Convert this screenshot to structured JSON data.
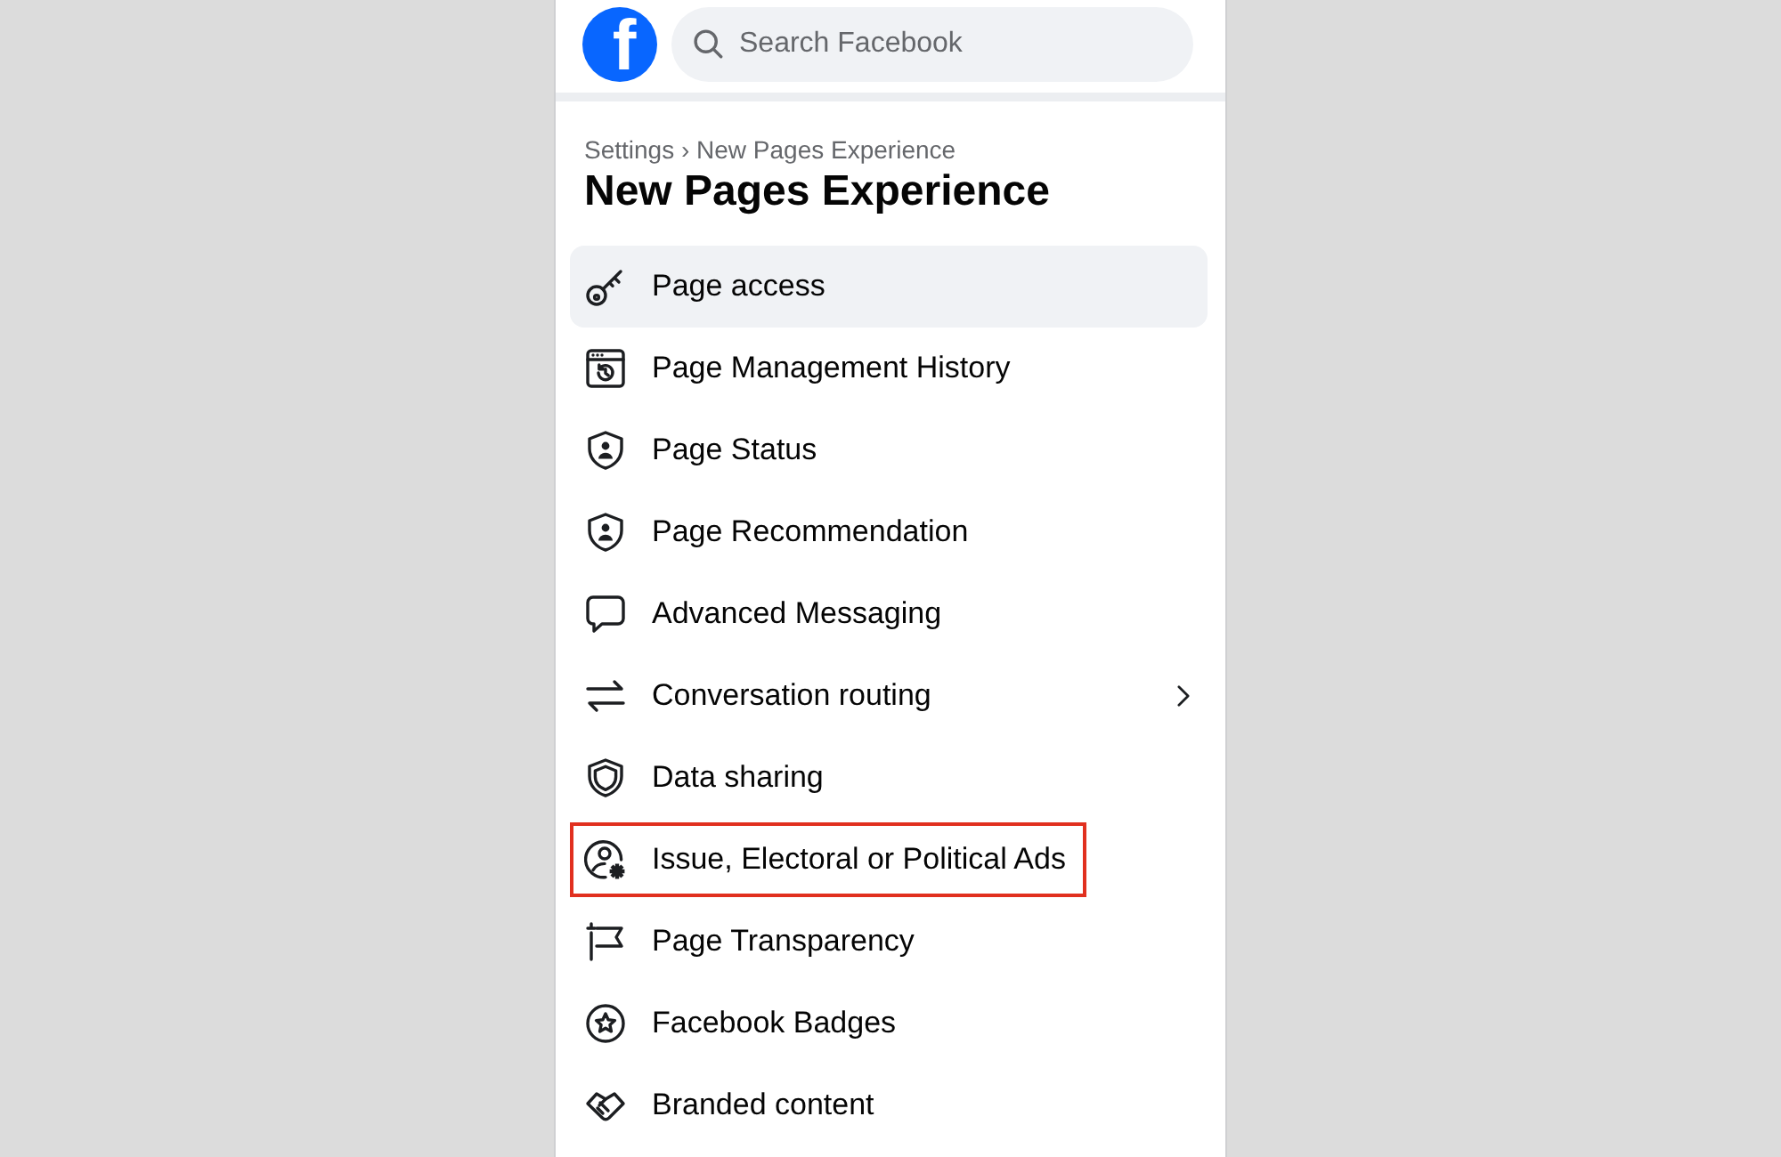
{
  "header": {
    "logo": {
      "letter": "f"
    },
    "search": {
      "placeholder": "Search Facebook"
    }
  },
  "breadcrumb": "Settings › New Pages Experience",
  "title": "New Pages Experience",
  "menu": {
    "items": [
      {
        "label": "Page access",
        "selected": true,
        "highlighted": false,
        "has_submenu": false
      },
      {
        "label": "Page Management History",
        "selected": false,
        "highlighted": false,
        "has_submenu": false
      },
      {
        "label": "Page Status",
        "selected": false,
        "highlighted": false,
        "has_submenu": false
      },
      {
        "label": "Page Recommendation",
        "selected": false,
        "highlighted": false,
        "has_submenu": false
      },
      {
        "label": "Advanced Messaging",
        "selected": false,
        "highlighted": false,
        "has_submenu": false
      },
      {
        "label": "Conversation routing",
        "selected": false,
        "highlighted": false,
        "has_submenu": true
      },
      {
        "label": "Data sharing",
        "selected": false,
        "highlighted": false,
        "has_submenu": false
      },
      {
        "label": "Issue, Electoral or Political Ads",
        "selected": false,
        "highlighted": true,
        "has_submenu": false
      },
      {
        "label": "Page Transparency",
        "selected": false,
        "highlighted": false,
        "has_submenu": false
      },
      {
        "label": "Facebook Badges",
        "selected": false,
        "highlighted": false,
        "has_submenu": false
      },
      {
        "label": "Branded content",
        "selected": false,
        "highlighted": false,
        "has_submenu": false
      }
    ]
  }
}
